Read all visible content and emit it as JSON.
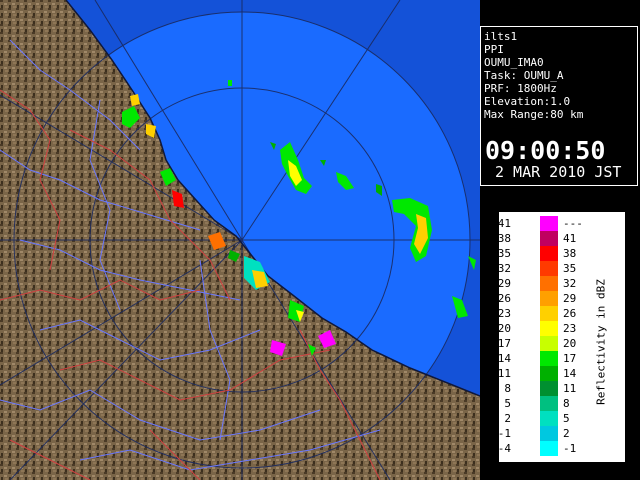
{
  "info": {
    "station": "ilts1",
    "scan_type": "PPI",
    "site_code": "OUMU_IMA0",
    "task": "Task: OUMU_A",
    "prf": "PRF: 1800Hz",
    "elevation": "Elevation:1.0",
    "max_range": "Max Range:80 km",
    "time": "09:00:50",
    "date": "2 MAR 2010 JST"
  },
  "legend": {
    "title": "Reflectivity in dBZ",
    "rows": [
      {
        "low": ">41",
        "high": "---",
        "color": "#ff00ff"
      },
      {
        "low": "38",
        "high": "41",
        "color": "#c00060"
      },
      {
        "low": "35",
        "high": "38",
        "color": "#ff0000"
      },
      {
        "low": "32",
        "high": "35",
        "color": "#ff3a00"
      },
      {
        "low": "29",
        "high": "32",
        "color": "#ff7000"
      },
      {
        "low": "26",
        "high": "29",
        "color": "#ffa000"
      },
      {
        "low": "23",
        "high": "26",
        "color": "#ffd000"
      },
      {
        "low": "20",
        "high": "23",
        "color": "#ffff00"
      },
      {
        "low": "17",
        "high": "20",
        "color": "#c8ff00"
      },
      {
        "low": "14",
        "high": "17",
        "color": "#00e800"
      },
      {
        "low": "11",
        "high": "14",
        "color": "#00b000"
      },
      {
        "low": "8",
        "high": "11",
        "color": "#009030"
      },
      {
        "low": "5",
        "high": "8",
        "color": "#00c080"
      },
      {
        "low": "2",
        "high": "5",
        "color": "#00e0c0"
      },
      {
        "low": "-1",
        "high": "2",
        "color": "#00c8e0"
      },
      {
        "low": "-4",
        "high": "-1",
        "color": "#00ffff"
      }
    ]
  },
  "map": {
    "sea_color": "#1a6bff",
    "outer_color": "#1452d8",
    "land_color": "#7a6548",
    "range_ring_color": "#1a2a60"
  }
}
